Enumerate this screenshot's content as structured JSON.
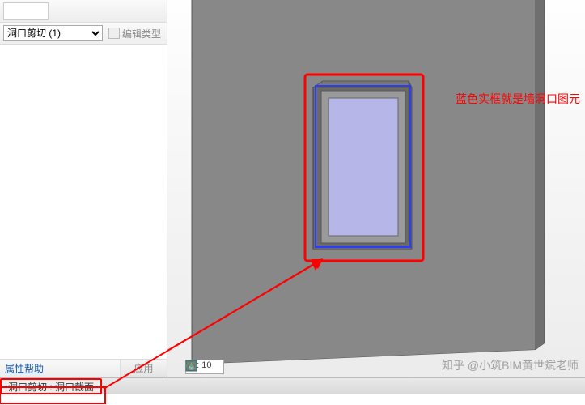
{
  "properties": {
    "type_selector_value": "洞口剪切 (1)",
    "edit_type_label": "编辑类型",
    "help_link": "属性帮助",
    "apply_label": "应用"
  },
  "viewport": {
    "scale_value": "1 : 10",
    "annotation_text": "蓝色实框就是墙洞口图元",
    "watermark": "知乎 @小筑BIM黄世斌老师"
  },
  "status": {
    "selection_info": "洞口剪切 : 洞口截面"
  },
  "colors": {
    "red": "#ff0000",
    "blue_sel": "#2a3cff",
    "wall": "#888888",
    "glass": "#b6b6e8"
  }
}
